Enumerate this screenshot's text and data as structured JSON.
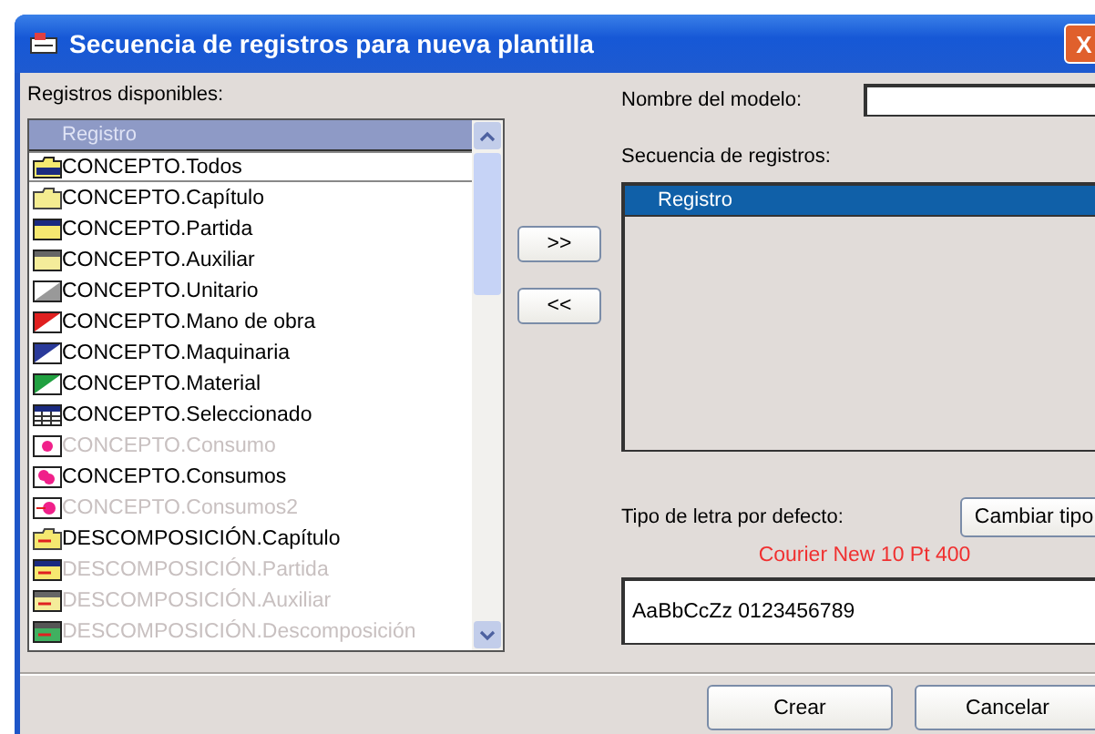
{
  "window": {
    "title": "Secuencia de registros para nueva plantilla",
    "close": "X"
  },
  "available": {
    "label": "Registros disponibles:",
    "column": "Registro",
    "items": [
      {
        "text": "CONCEPTO.Todos",
        "kind": "folder-dark",
        "disabled": false,
        "selected": true
      },
      {
        "text": "CONCEPTO.Capítulo",
        "kind": "folder",
        "disabled": false,
        "selected": false
      },
      {
        "text": "CONCEPTO.Partida",
        "kind": "partida",
        "disabled": false,
        "selected": false
      },
      {
        "text": "CONCEPTO.Auxiliar",
        "kind": "auxiliar",
        "disabled": false,
        "selected": false
      },
      {
        "text": "CONCEPTO.Unitario",
        "kind": "unitario",
        "disabled": false,
        "selected": false
      },
      {
        "text": "CONCEPTO.Mano de obra",
        "kind": "mano",
        "disabled": false,
        "selected": false
      },
      {
        "text": "CONCEPTO.Maquinaria",
        "kind": "maquinaria",
        "disabled": false,
        "selected": false
      },
      {
        "text": "CONCEPTO.Material",
        "kind": "material",
        "disabled": false,
        "selected": false
      },
      {
        "text": "CONCEPTO.Seleccionado",
        "kind": "grid",
        "disabled": false,
        "selected": false
      },
      {
        "text": "CONCEPTO.Consumo",
        "kind": "consumo",
        "disabled": true,
        "selected": false
      },
      {
        "text": "CONCEPTO.Consumos",
        "kind": "consumos",
        "disabled": false,
        "selected": false
      },
      {
        "text": "CONCEPTO.Consumos2",
        "kind": "consumos2",
        "disabled": true,
        "selected": false
      },
      {
        "text": "DESCOMPOSICIÓN.Capítulo",
        "kind": "desc-folder",
        "disabled": false,
        "selected": false
      },
      {
        "text": "DESCOMPOSICIÓN.Partida",
        "kind": "desc-partida",
        "disabled": true,
        "selected": false
      },
      {
        "text": "DESCOMPOSICIÓN.Auxiliar",
        "kind": "desc-auxiliar",
        "disabled": true,
        "selected": false
      },
      {
        "text": "DESCOMPOSICIÓN.Descomposición",
        "kind": "desc-grid",
        "disabled": true,
        "selected": false
      }
    ]
  },
  "move_buttons": [
    ">>",
    "<<"
  ],
  "model_name": {
    "label": "Nombre del modelo:"
  },
  "sequence": {
    "label": "Secuencia de registros:",
    "column": "Registro"
  },
  "font": {
    "label": "Tipo de letra por defecto:",
    "button": "Cambiar tipo",
    "name": "Courier New 10 Pt 400",
    "sample": "AaBbCcZz 0123456789"
  },
  "buttons": [
    "Crear",
    "Cancelar"
  ]
}
